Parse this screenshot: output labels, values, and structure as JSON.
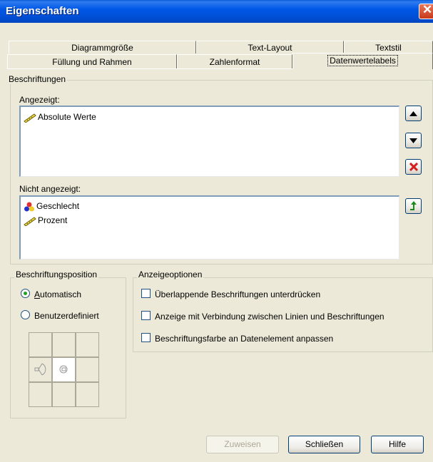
{
  "window": {
    "title": "Eigenschaften",
    "close_icon": "close-icon"
  },
  "tabs_row1": [
    "Diagrammgröße",
    "Text-Layout",
    "Textstil"
  ],
  "tabs_row2": [
    "Füllung und Rahmen",
    "Zahlenformat",
    "Datenwertelabels"
  ],
  "labels_group": {
    "title": "Beschriftungen",
    "shown_label": "Angezeigt:",
    "shown_items": [
      "Absolute Werte"
    ],
    "hidden_label": "Nicht angezeigt:",
    "hidden_items": [
      "Geschlecht",
      "Prozent"
    ]
  },
  "position_group": {
    "title": "Beschriftungsposition",
    "options": [
      "Automatisch",
      "Benutzerdefiniert"
    ],
    "selected": "Automatisch"
  },
  "display_group": {
    "title": "Anzeigeoptionen",
    "options": [
      "Überlappende Beschriftungen unterdrücken",
      "Anzeige mit Verbindung zwischen Linien und Beschriftungen",
      "Beschriftungsfarbe an Datenelement anpassen"
    ]
  },
  "buttons": {
    "apply": "Zuweisen",
    "close": "Schließen",
    "help": "Hilfe"
  },
  "colors": {
    "accent": "#0058e6",
    "delete": "#d21f1f",
    "move": "#1a8a1a"
  }
}
